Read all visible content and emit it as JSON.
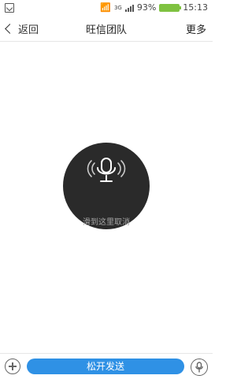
{
  "status_bar": {
    "battery_percent": "93%",
    "time": "15:13",
    "network": "3G"
  },
  "nav": {
    "back_label": "返回",
    "title": "旺信团队",
    "more_label": "更多"
  },
  "overlay": {
    "hint": "滑到这里取消"
  },
  "bottom": {
    "send_label": "松开发送"
  },
  "colors": {
    "accent": "#2f91e5",
    "overlay_bg": "#2a2a2a",
    "battery": "#7fc241"
  }
}
